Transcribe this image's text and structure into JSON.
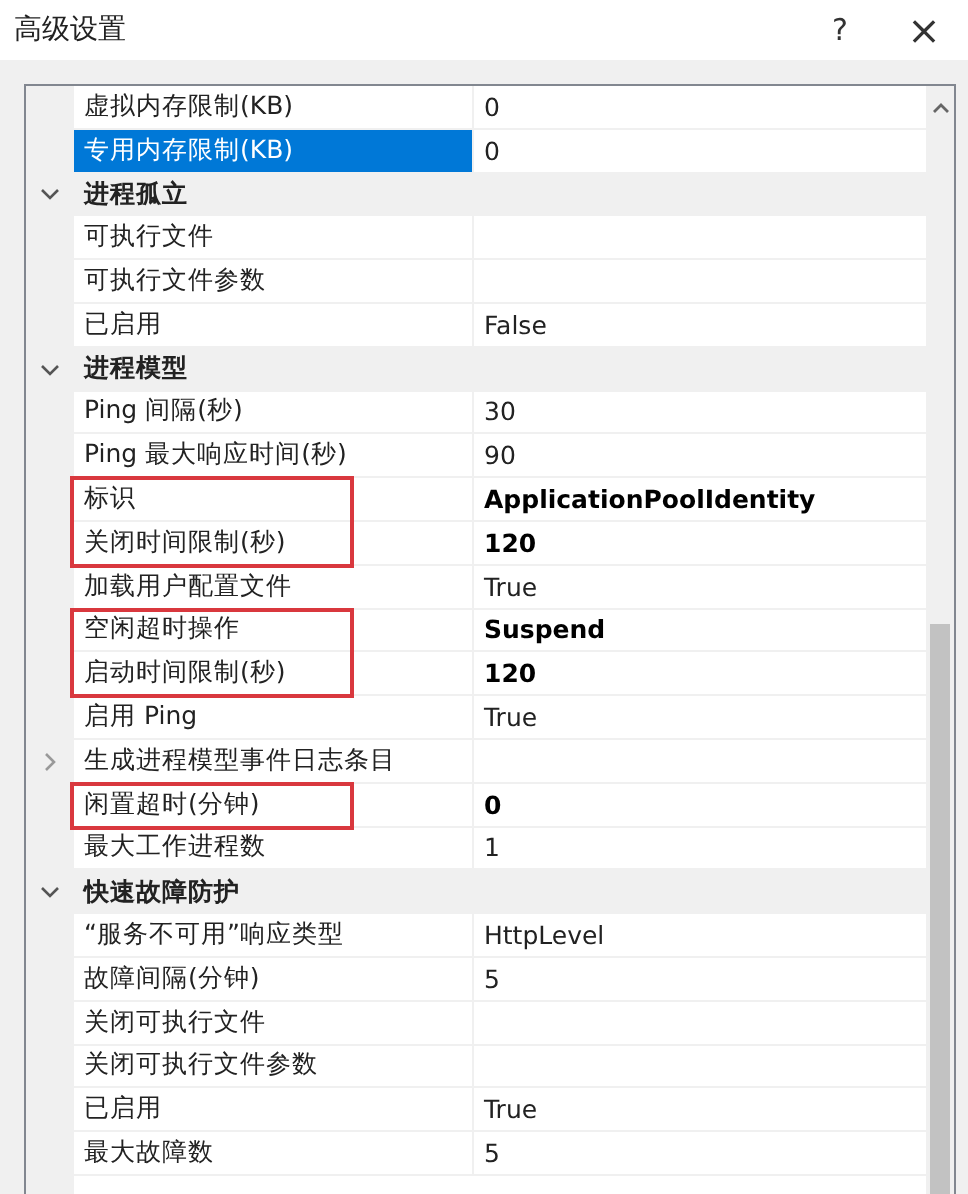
{
  "window": {
    "title": "高级设置",
    "help": "?",
    "close": "×"
  },
  "rows": [
    {
      "kind": "property",
      "label": "虚拟内存限制(KB)",
      "value": "0",
      "selected": false,
      "modified": false
    },
    {
      "kind": "property",
      "label": "专用内存限制(KB)",
      "value": "0",
      "selected": true,
      "modified": false
    },
    {
      "kind": "category",
      "label": "进程孤立",
      "expanded": true
    },
    {
      "kind": "property",
      "label": "可执行文件",
      "selected": false
    },
    {
      "kind": "property",
      "label": "可执行文件参数",
      "selected": false
    },
    {
      "kind": "property",
      "label": "已启用",
      "value": "False",
      "selected": false,
      "modified": false
    },
    {
      "kind": "category",
      "label": "进程模型",
      "expanded": true
    },
    {
      "kind": "property",
      "label": "Ping 间隔(秒)",
      "value": "30",
      "selected": false,
      "modified": false
    },
    {
      "kind": "property",
      "label": "Ping 最大响应时间(秒)",
      "value": "90",
      "selected": false,
      "modified": false
    },
    {
      "kind": "property",
      "label": "标识",
      "value": "ApplicationPoolIdentity",
      "selected": false,
      "modified": true,
      "annotated": true
    },
    {
      "kind": "property",
      "label": "关闭时间限制(秒)",
      "value": "120",
      "selected": false,
      "modified": true,
      "annotated": true
    },
    {
      "kind": "property",
      "label": "加载用户配置文件",
      "value": "True",
      "selected": false,
      "modified": false
    },
    {
      "kind": "property",
      "label": "空闲超时操作",
      "value": "Suspend",
      "selected": false,
      "modified": true,
      "annotated": true
    },
    {
      "kind": "property",
      "label": "启动时间限制(秒)",
      "value": "120",
      "selected": false,
      "modified": true,
      "annotated": true
    },
    {
      "kind": "property",
      "label": "启用 Ping",
      "value": "True",
      "selected": false,
      "modified": false
    },
    {
      "kind": "expandable",
      "label": "生成进程模型事件日志条目",
      "expanded": false,
      "selected": false
    },
    {
      "kind": "property",
      "label": "闲置超时(分钟)",
      "value": "0",
      "selected": false,
      "modified": true,
      "annotated": true
    },
    {
      "kind": "property",
      "label": "最大工作进程数",
      "value": "1",
      "selected": false,
      "modified": false
    },
    {
      "kind": "category",
      "label": "快速故障防护",
      "expanded": true
    },
    {
      "kind": "property",
      "label": "“服务不可用”响应类型",
      "value": "HttpLevel",
      "selected": false,
      "modified": false
    },
    {
      "kind": "property",
      "label": "故障间隔(分钟)",
      "value": "5",
      "selected": false,
      "modified": false
    },
    {
      "kind": "property",
      "label": "关闭可执行文件",
      "selected": false
    },
    {
      "kind": "property",
      "label": "关闭可执行文件参数",
      "selected": false
    },
    {
      "kind": "property",
      "label": "已启用",
      "value": "True",
      "selected": false,
      "modified": false
    },
    {
      "kind": "property",
      "label": "最大故障数",
      "value": "5",
      "selected": false,
      "modified": false
    }
  ]
}
